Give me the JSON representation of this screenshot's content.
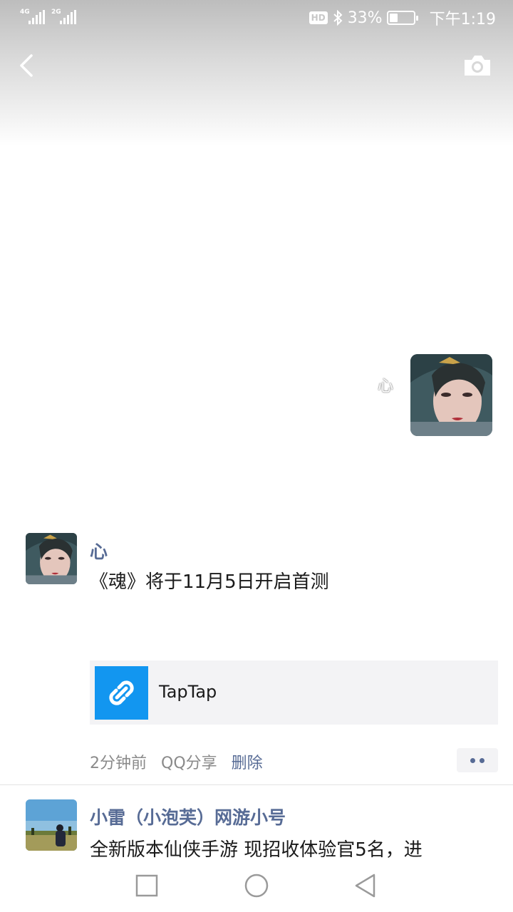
{
  "status_bar": {
    "signal1_label": "4G",
    "signal2_label": "2G",
    "hd_label": "HD",
    "bluetooth_icon": "bluetooth-icon",
    "battery_text": "33%",
    "battery_level": 0.33,
    "time": "下午1:19"
  },
  "header": {
    "back_icon": "chevron-left-icon",
    "camera_icon": "camera-icon"
  },
  "cover": {
    "name": "心"
  },
  "post": {
    "author": "心",
    "text": "《魂》将于11月5日开启首测",
    "link": {
      "icon": "link-icon",
      "title": "TapTap"
    },
    "time": "2分钟前",
    "source": "QQ分享",
    "delete_label": "删除",
    "more_icon": "more-dots-icon"
  },
  "next_post": {
    "author": "小雷（小泡芙）网游小号",
    "text": "全新版本仙侠手游 现招收体验官5名，进"
  },
  "nav_bar": {
    "recent_icon": "square-icon",
    "home_icon": "circle-icon",
    "back_icon": "triangle-back-icon"
  },
  "colors": {
    "link_blue": "#576b95",
    "link_icon_bg": "#1296f0",
    "card_bg": "#f3f3f5"
  }
}
